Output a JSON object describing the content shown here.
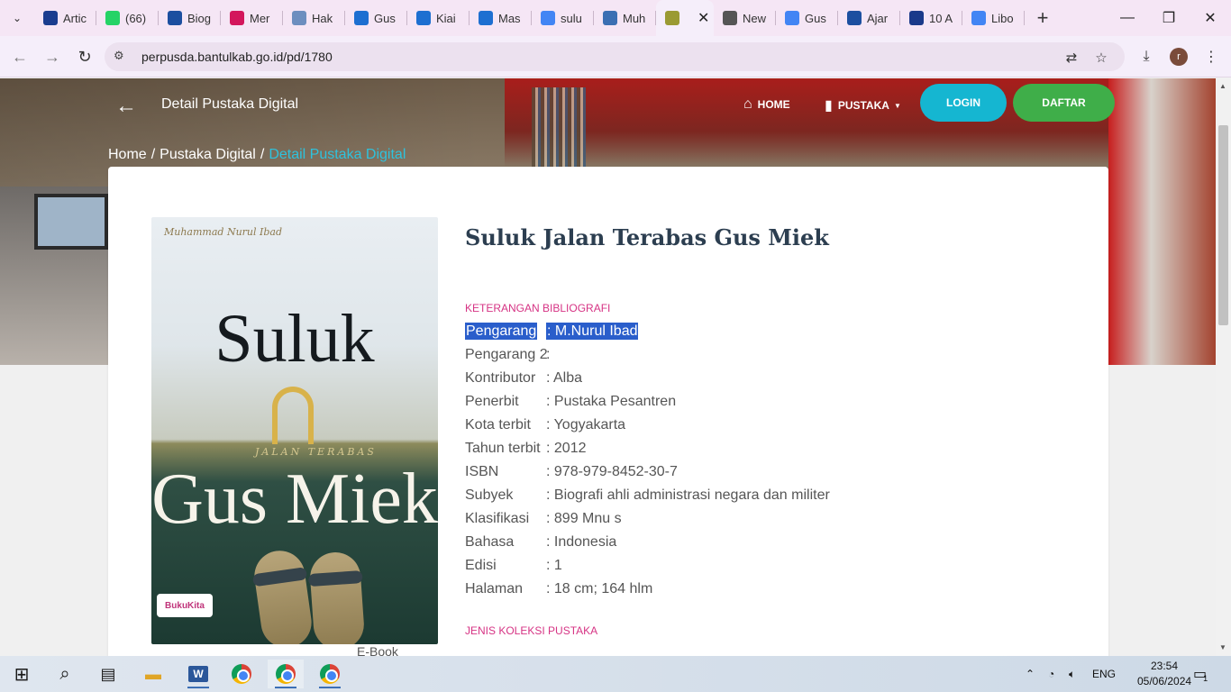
{
  "browser": {
    "tabs": [
      {
        "label": "Artic",
        "icon": "ro-icon",
        "color": "#1a3d8f"
      },
      {
        "label": "(66)",
        "icon": "whatsapp-icon",
        "color": "#25d366"
      },
      {
        "label": "Biog",
        "icon": "blue-app-icon",
        "color": "#1c4fa0"
      },
      {
        "label": "Mer",
        "icon": "u-icon",
        "color": "#d3165c"
      },
      {
        "label": "Hak",
        "icon": "puzzle-icon",
        "color": "#6c8ebf"
      },
      {
        "label": "Gus",
        "icon": "bookmark-icon",
        "color": "#1d6fd1"
      },
      {
        "label": "Kiai",
        "icon": "bookmark-icon",
        "color": "#1d6fd1"
      },
      {
        "label": "Mas",
        "icon": "bookmark-icon",
        "color": "#1d6fd1"
      },
      {
        "label": "sulu",
        "icon": "google-icon",
        "color": "#4285f4"
      },
      {
        "label": "Muh",
        "icon": "doc-icon",
        "color": "#3b6fb3"
      },
      {
        "label": "",
        "icon": "bantul-logo-icon",
        "color": "#9a9a33",
        "active": true
      },
      {
        "label": "New",
        "icon": "chrome-icon",
        "color": "#555555"
      },
      {
        "label": "Gus",
        "icon": "google-icon",
        "color": "#4285f4"
      },
      {
        "label": "Ajar",
        "icon": "blue-app-icon",
        "color": "#1c4fa0"
      },
      {
        "label": "10 A",
        "icon": "p-icon",
        "color": "#1a3a8a"
      },
      {
        "label": "Libo",
        "icon": "google-icon",
        "color": "#4285f4"
      }
    ],
    "url": "perpusda.bantulkab.go.id/pd/1780"
  },
  "site": {
    "page_heading": "Detail Pustaka Digital",
    "nav": {
      "home": "HOME",
      "pustaka": "PUSTAKA",
      "login": "LOGIN",
      "daftar": "DAFTAR"
    },
    "breadcrumb": {
      "home": "Home",
      "parent": "Pustaka Digital",
      "current": "Detail Pustaka Digital",
      "separator": "/"
    }
  },
  "book": {
    "cover": {
      "author": "Muhammad Nurul Ibad",
      "title_top": "Suluk",
      "subtitle": "JALAN TERABAS",
      "title_bottom": "Gus Miek",
      "publisher_logo": "BukuKita"
    },
    "title": "Suluk Jalan Terabas Gus Miek",
    "bibliography_label": "KETERANGAN BIBLIOGRAFI",
    "metadata": [
      {
        "key": "Pengarang",
        "value": ": M.Nurul Ibad",
        "selected": true
      },
      {
        "key": "Pengarang 2",
        "value": ":"
      },
      {
        "key": "Kontributor",
        "value": ": Alba"
      },
      {
        "key": "Penerbit",
        "value": ": Pustaka Pesantren"
      },
      {
        "key": "Kota terbit",
        "value": ": Yogyakarta"
      },
      {
        "key": "Tahun terbit",
        "value": ": 2012"
      },
      {
        "key": "ISBN",
        "value": ": 978-979-8452-30-7"
      },
      {
        "key": "Subyek",
        "value": ": Biografi ahli administrasi negara dan militer"
      },
      {
        "key": "Klasifikasi",
        "value": ": 899 Mnu s"
      },
      {
        "key": "Bahasa",
        "value": ": Indonesia"
      },
      {
        "key": "Edisi",
        "value": ": 1"
      },
      {
        "key": "Halaman",
        "value": ": 18 cm; 164 hlm"
      }
    ],
    "collection_label": "JENIS KOLEKSI PUSTAKA",
    "collection_value": "E-Book"
  },
  "taskbar": {
    "language": "ENG",
    "time": "23:54",
    "date": "05/06/2024",
    "notification_count": "1"
  },
  "colors": {
    "accent_cyan": "#15b6d1",
    "accent_green": "#3fae49",
    "section_pink": "#d63384",
    "selection_blue": "#2a5ecb"
  }
}
